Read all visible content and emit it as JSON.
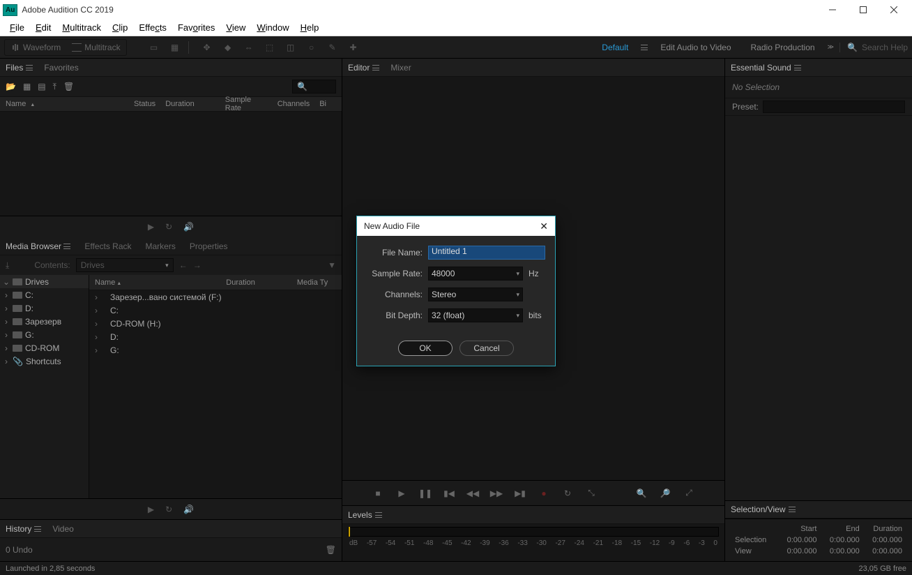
{
  "titlebar": {
    "app": "Adobe Audition CC 2019",
    "badge": "Au"
  },
  "menubar": [
    {
      "l": "File",
      "u": "F",
      "r": "ile"
    },
    {
      "l": "Edit",
      "u": "E",
      "r": "dit"
    },
    {
      "l": "Multitrack",
      "u": "M",
      "r": "ultitrack"
    },
    {
      "l": "Clip",
      "u": "C",
      "r": "lip"
    },
    {
      "l": "Effects",
      "u": "",
      "r": "Effects"
    },
    {
      "l": "Favorites",
      "u": "",
      "r": "Favorites"
    },
    {
      "l": "View",
      "u": "V",
      "r": "iew"
    },
    {
      "l": "Window",
      "u": "W",
      "r": "indow"
    },
    {
      "l": "Help",
      "u": "H",
      "r": "elp"
    }
  ],
  "toolbar": {
    "waveform": "Waveform",
    "multitrack": "Multitrack",
    "workspaces": {
      "default": "Default",
      "editav": "Edit Audio to Video",
      "radio": "Radio Production"
    },
    "search_ph": "Search Help"
  },
  "files_panel": {
    "tabs": {
      "files": "Files",
      "favorites": "Favorites"
    },
    "cols": {
      "name": "Name",
      "status": "Status",
      "duration": "Duration",
      "sr": "Sample Rate",
      "ch": "Channels",
      "bd": "Bi"
    }
  },
  "media_browser": {
    "tabs": {
      "mb": "Media Browser",
      "er": "Effects Rack",
      "mk": "Markers",
      "pr": "Properties"
    },
    "contents_lbl": "Contents:",
    "contents_val": "Drives",
    "left_cols": {
      "drives": "Drives"
    },
    "left_tree": [
      "C:",
      "D:",
      "Зарезерв",
      "G:",
      "CD-ROM",
      "Shortcuts"
    ],
    "right_cols": {
      "name": "Name",
      "duration": "Duration",
      "mt": "Media Ty"
    },
    "right_rows": [
      "Зарезер...вано системой (F:)",
      "C:",
      "CD-ROM (H:)",
      "D:",
      "G:"
    ]
  },
  "history": {
    "tabs": {
      "history": "History",
      "video": "Video"
    },
    "undo": "0 Undo"
  },
  "editor": {
    "tabs": {
      "editor": "Editor",
      "mixer": "Mixer"
    }
  },
  "levels": {
    "tab": "Levels",
    "db": [
      "dB",
      "-57",
      "-54",
      "-51",
      "-48",
      "-45",
      "-42",
      "-39",
      "-36",
      "-33",
      "-30",
      "-27",
      "-24",
      "-21",
      "-18",
      "-15",
      "-12",
      "-9",
      "-6",
      "-3",
      "0"
    ]
  },
  "essential_sound": {
    "tab": "Essential Sound",
    "nosel": "No Selection",
    "preset_lbl": "Preset:"
  },
  "selview": {
    "tab": "Selection/View",
    "cols": {
      "start": "Start",
      "end": "End",
      "dur": "Duration"
    },
    "rows": [
      {
        "l": "Selection",
        "s": "0:00.000",
        "e": "0:00.000",
        "d": "0:00.000"
      },
      {
        "l": "View",
        "s": "0:00.000",
        "e": "0:00.000",
        "d": "0:00.000"
      }
    ]
  },
  "status": {
    "left": "Launched in 2,85 seconds",
    "right": "23,05 GB free"
  },
  "dialog": {
    "title": "New Audio File",
    "filename_lbl": "File Name:",
    "filename_val": "Untitled 1",
    "sr_lbl": "Sample Rate:",
    "sr_val": "48000",
    "sr_unit": "Hz",
    "ch_lbl": "Channels:",
    "ch_val": "Stereo",
    "bd_lbl": "Bit Depth:",
    "bd_val": "32 (float)",
    "bd_unit": "bits",
    "ok": "OK",
    "cancel": "Cancel"
  }
}
